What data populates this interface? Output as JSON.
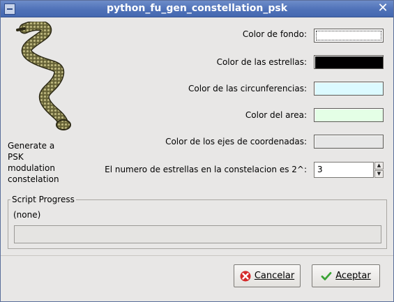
{
  "window": {
    "title": "python_fu_gen_constellation_psk"
  },
  "description": "Generate a\nPSK\nmodulation\nconstelation",
  "settings": [
    {
      "label": "Color de fondo:",
      "color": "#ffffff"
    },
    {
      "label": "Color de las estrellas:",
      "color": "#000000"
    },
    {
      "label": "Color de las circunferencias:",
      "color": "#dcfaff"
    },
    {
      "label": "Color del area:",
      "color": "#e4ffe6"
    },
    {
      "label": "Color de los ejes de coordenadas:",
      "color": "#e6e6e6"
    }
  ],
  "spinner": {
    "label": "El numero de estrellas en la constelacion es 2^:",
    "value": "3"
  },
  "progress": {
    "title": "Script Progress",
    "status": "(none)",
    "fraction": 0
  },
  "buttons": {
    "cancel": "Cancelar",
    "ok": "Aceptar"
  },
  "icons": {
    "snake": "snake-image",
    "close": "close-icon",
    "menu": "window-menu-icon",
    "cancel": "cancel-x-icon",
    "ok": "checkmark-icon"
  }
}
